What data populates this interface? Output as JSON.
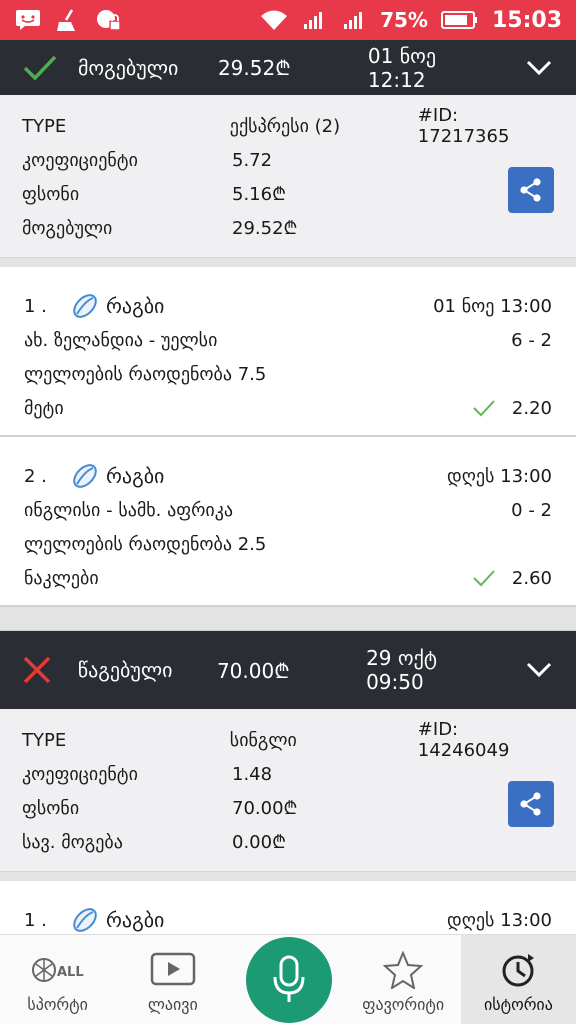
{
  "status_bar": {
    "battery": "75%",
    "time": "15:03"
  },
  "bets": [
    {
      "status": "მოგებული",
      "amount": "29.52₾",
      "date": "01 ნოე 12:12",
      "type_label": "TYPE",
      "type_value": "ექსპრესი (2)",
      "id": "#ID: 17217365",
      "rows": [
        {
          "label": "კოეფიციენტი",
          "value": "5.72"
        },
        {
          "label": "ფსონი",
          "value": "5.16₾"
        },
        {
          "label": "მოგებული",
          "value": "29.52₾"
        }
      ],
      "selections": [
        {
          "num": "1 .",
          "sport": "რაგბი",
          "time": "01 ნოე 13:00",
          "match": "ახ. ზელანდია - უელსი",
          "score": "6 - 2",
          "market": "ლელოების რაოდენობა 7.5",
          "pick": "მეტი",
          "odds": "2.20"
        },
        {
          "num": "2 .",
          "sport": "რაგბი",
          "time": "დღეს 13:00",
          "match": "ინგლისი - სამხ. აფრიკა",
          "score": "0 - 2",
          "market": "ლელოების რაოდენობა 2.5",
          "pick": "ნაკლები",
          "odds": "2.60"
        }
      ]
    },
    {
      "status": "წაგებული",
      "amount": "70.00₾",
      "date": "29 ოქტ 09:50",
      "type_label": "TYPE",
      "type_value": "სინგლი",
      "id": "#ID: 14246049",
      "rows": [
        {
          "label": "კოეფიციენტი",
          "value": "1.48"
        },
        {
          "label": "ფსონი",
          "value": "70.00₾"
        },
        {
          "label": "სავ. მოგება",
          "value": "0.00₾"
        }
      ],
      "selections": [
        {
          "num": "1 .",
          "sport": "რაგბი",
          "time": "დღეს 13:00"
        }
      ]
    }
  ],
  "nav": {
    "sports": "სპორტი",
    "live": "ლაივი",
    "favorites": "ფავორიტი",
    "history": "ისტორია",
    "all_badge": "ALL"
  },
  "colors": {
    "status_bar": "#e8394a",
    "header": "#2a2d33",
    "win": "#4caf50",
    "loss": "#e53935",
    "share": "#3b6fc4",
    "mic": "#1b9a74"
  }
}
